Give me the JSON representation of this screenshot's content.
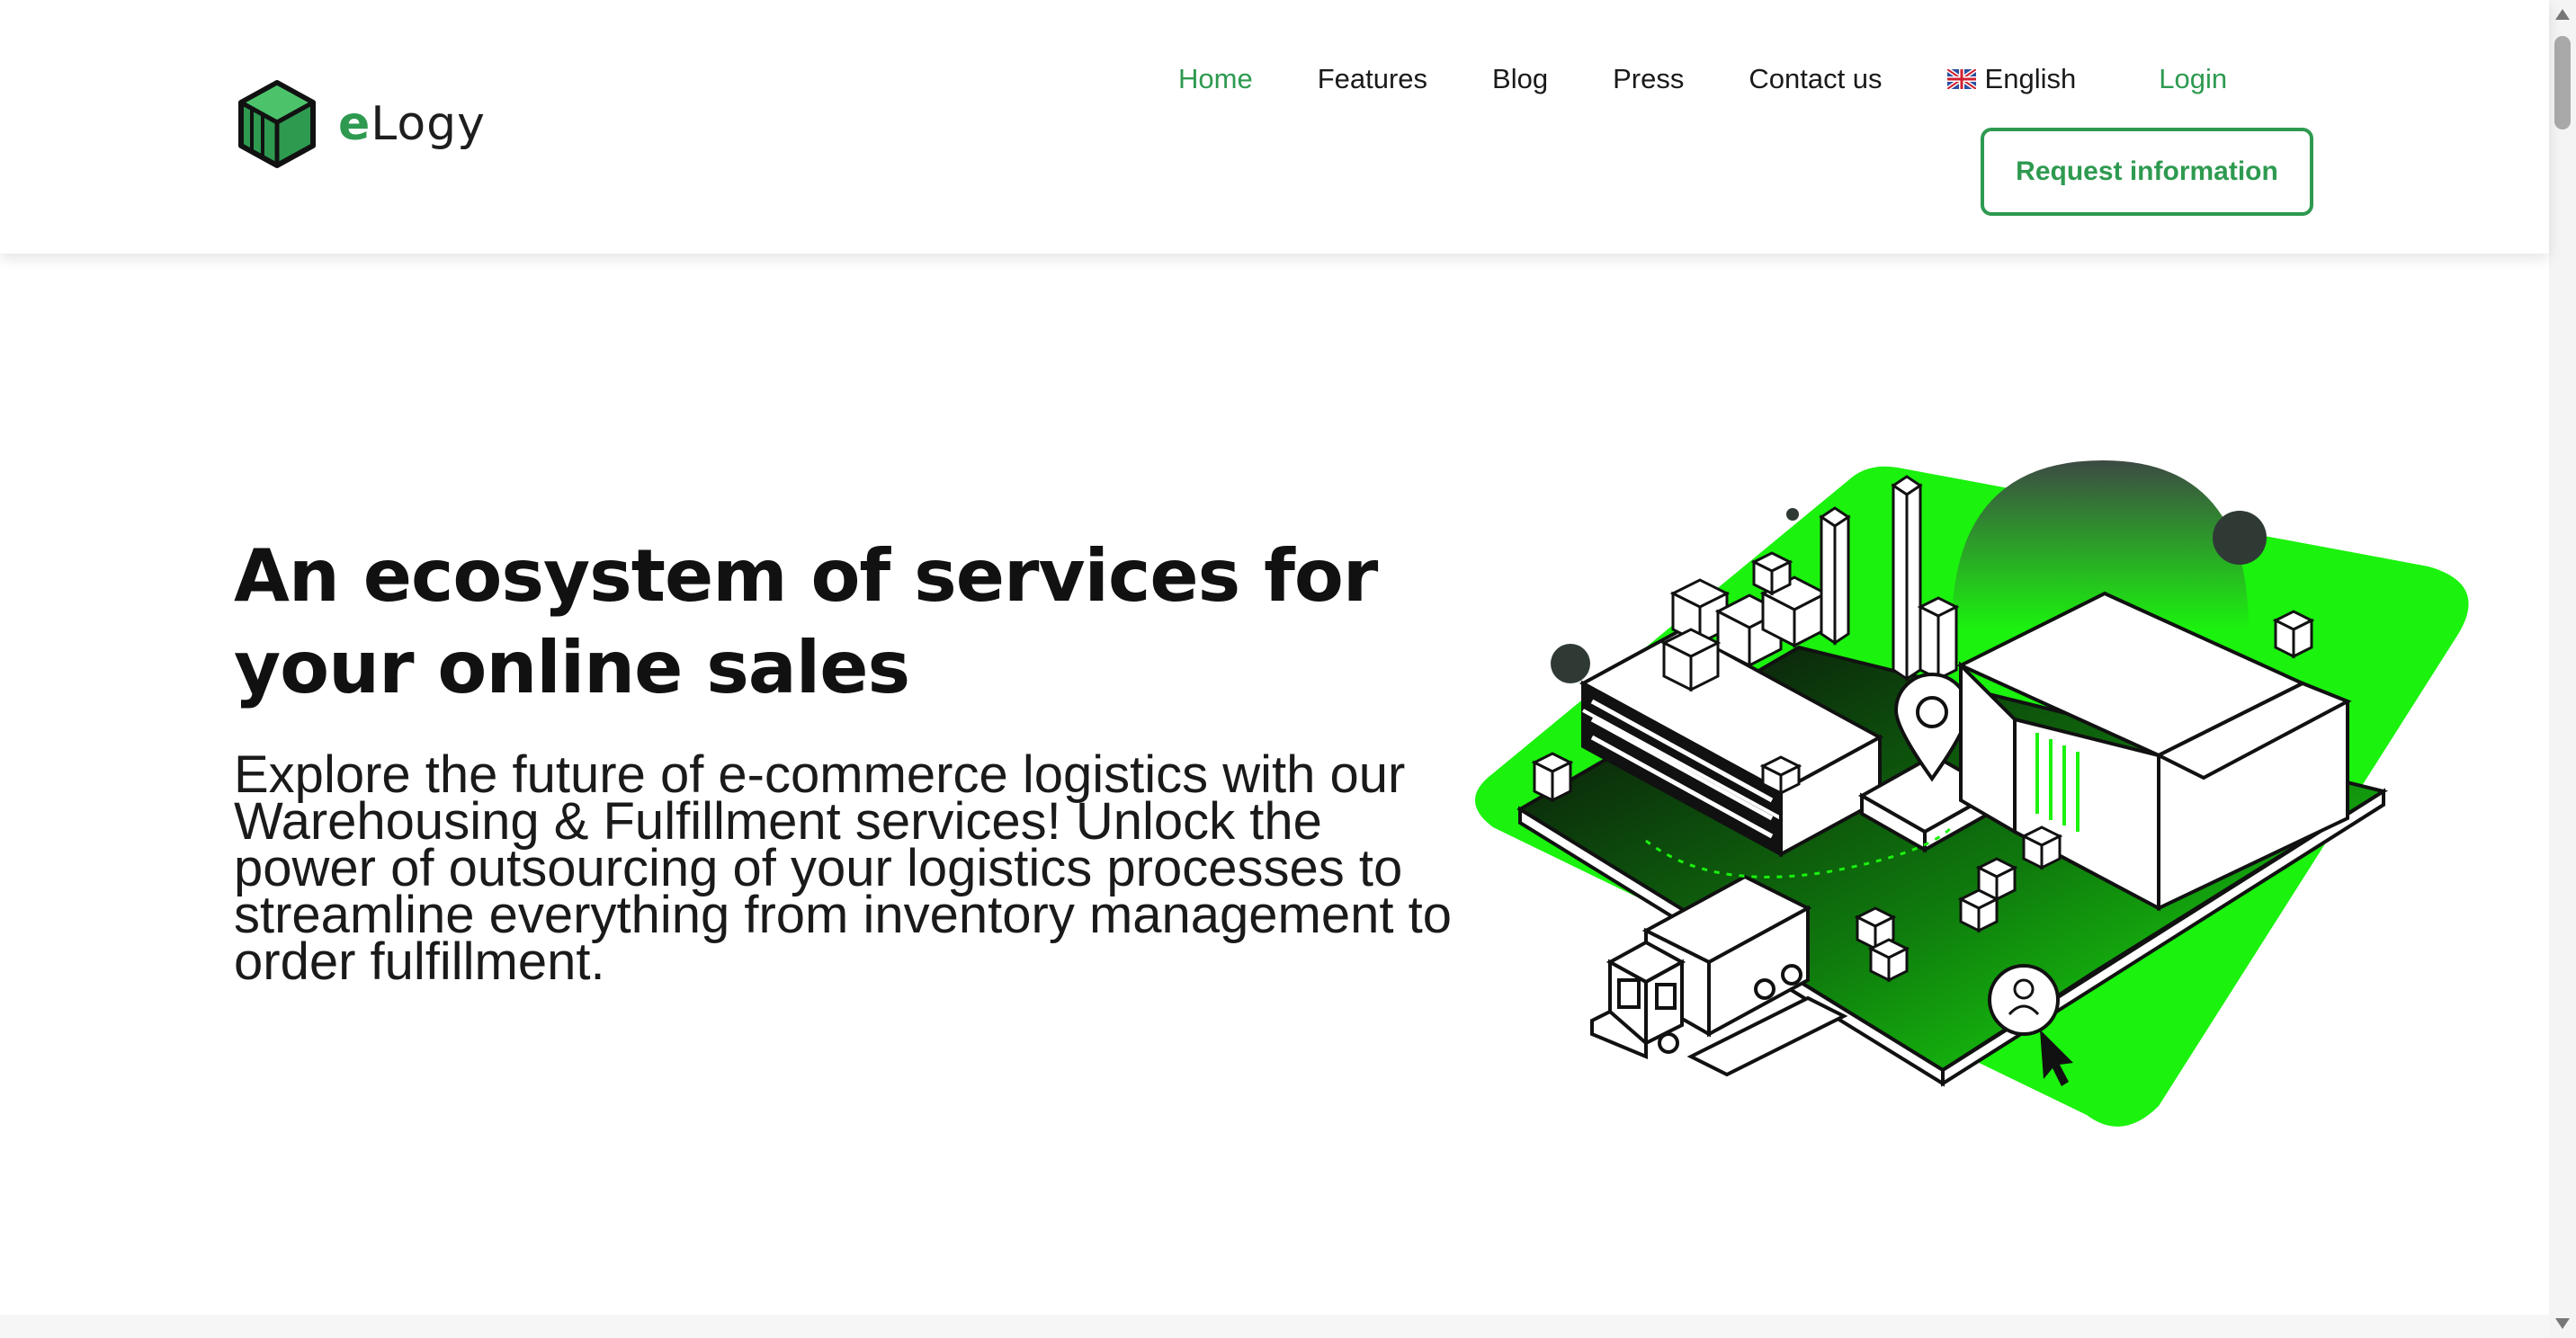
{
  "brand": {
    "name_prefix": "e",
    "name_rest": "Logy",
    "color": "#2e9a50"
  },
  "nav": {
    "items": [
      {
        "label": "Home",
        "active": true
      },
      {
        "label": "Features"
      },
      {
        "label": "Blog"
      },
      {
        "label": "Press"
      },
      {
        "label": "Contact us"
      }
    ],
    "language": {
      "label": "English",
      "icon": "uk-flag-icon"
    },
    "login": "Login",
    "request_button": "Request information"
  },
  "hero": {
    "title": "An ecosystem of services for your online sales",
    "description": "Explore the future of e-commerce logistics with our Warehousing & Fulfillment services! Unlock the power of outsourcing of your logistics processes to streamline everything from inventory management to order fulfillment.",
    "illustration": "isometric-warehouse-illustration",
    "accent_color": "#1bf20e"
  }
}
